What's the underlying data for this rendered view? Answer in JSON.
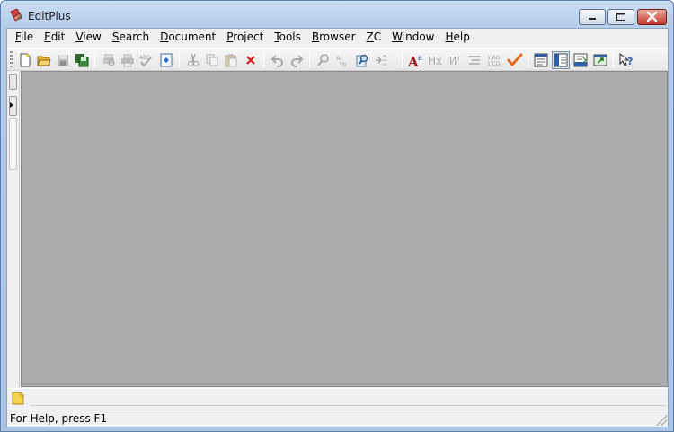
{
  "window": {
    "title": "EditPlus",
    "icon": "editplus-app-icon",
    "controls": [
      "minimize-icon",
      "maximize-icon",
      "close-icon"
    ]
  },
  "menu": [
    {
      "id": "file",
      "label": "File"
    },
    {
      "id": "edit",
      "label": "Edit"
    },
    {
      "id": "view",
      "label": "View"
    },
    {
      "id": "search",
      "label": "Search"
    },
    {
      "id": "document",
      "label": "Document"
    },
    {
      "id": "project",
      "label": "Project"
    },
    {
      "id": "tools",
      "label": "Tools"
    },
    {
      "id": "browser",
      "label": "Browser"
    },
    {
      "id": "zc",
      "label": "ZC"
    },
    {
      "id": "window",
      "label": "Window"
    },
    {
      "id": "help",
      "label": "Help"
    }
  ],
  "toolbar": {
    "buttons": [
      {
        "id": "new",
        "icon": "new-file-icon",
        "enabled": true
      },
      {
        "id": "open",
        "icon": "open-folder-icon",
        "enabled": true
      },
      {
        "id": "save",
        "icon": "save-icon",
        "enabled": false
      },
      {
        "id": "save-all",
        "icon": "save-all-icon",
        "enabled": true
      },
      {
        "id": "print-preview",
        "icon": "print-preview-icon",
        "enabled": false
      },
      {
        "id": "print",
        "icon": "print-icon",
        "enabled": false
      },
      {
        "id": "spell-check",
        "icon": "spell-check-icon",
        "enabled": false
      },
      {
        "id": "view-in-browser",
        "icon": "browser-view-icon",
        "enabled": true
      },
      {
        "id": "cut",
        "icon": "cut-icon",
        "enabled": false
      },
      {
        "id": "copy",
        "icon": "copy-icon",
        "enabled": false
      },
      {
        "id": "paste",
        "icon": "paste-icon",
        "enabled": false
      },
      {
        "id": "delete",
        "icon": "delete-icon",
        "enabled": true
      },
      {
        "id": "undo",
        "icon": "undo-icon",
        "enabled": false
      },
      {
        "id": "redo",
        "icon": "redo-icon",
        "enabled": false
      },
      {
        "id": "find",
        "icon": "find-icon",
        "enabled": false
      },
      {
        "id": "replace",
        "icon": "replace-icon",
        "enabled": false
      },
      {
        "id": "find-in-files",
        "icon": "find-in-files-icon",
        "enabled": true
      },
      {
        "id": "goto-line",
        "icon": "goto-line-icon",
        "enabled": false
      },
      {
        "id": "font",
        "icon": "font-icon",
        "enabled": true
      },
      {
        "id": "html-heading",
        "icon": "heading-icon",
        "enabled": false
      },
      {
        "id": "word-wrap",
        "icon": "word-wrap-icon",
        "enabled": false
      },
      {
        "id": "line-number",
        "icon": "line-number-icon",
        "enabled": false
      },
      {
        "id": "ruler",
        "icon": "column-ruler-icon",
        "enabled": false
      },
      {
        "id": "check",
        "icon": "checkmark-icon",
        "enabled": true
      },
      {
        "id": "directory-window",
        "icon": "directory-window-icon",
        "enabled": true
      },
      {
        "id": "cliptext-window",
        "icon": "cliptext-window-icon",
        "enabled": true,
        "pressed": true
      },
      {
        "id": "output-window",
        "icon": "output-window-icon",
        "enabled": true
      },
      {
        "id": "full-screen",
        "icon": "full-screen-icon",
        "enabled": true
      },
      {
        "id": "context-help",
        "icon": "context-help-icon",
        "enabled": true
      }
    ]
  },
  "document_tabs": {
    "icon": "document-tab-icon"
  },
  "status": {
    "text": "For Help, press F1"
  },
  "colors": {
    "mdi_background": "#ababab",
    "chrome": "#f0f0f0",
    "title_gradient_top": "#c9dcf2",
    "close_button": "#c1382b"
  }
}
